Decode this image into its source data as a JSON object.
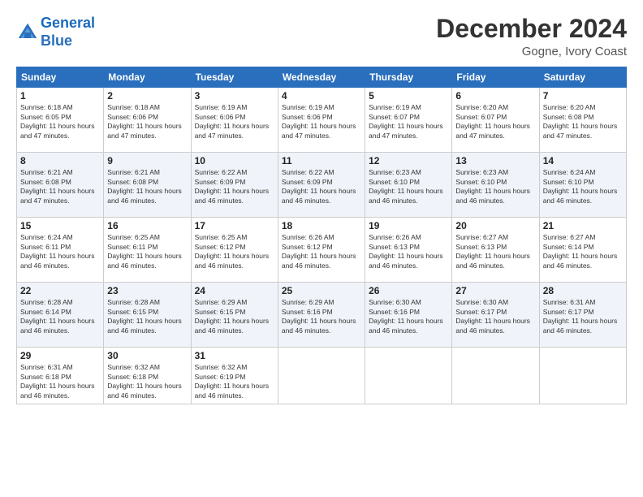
{
  "header": {
    "logo_line1": "General",
    "logo_line2": "Blue",
    "month": "December 2024",
    "location": "Gogne, Ivory Coast"
  },
  "weekdays": [
    "Sunday",
    "Monday",
    "Tuesday",
    "Wednesday",
    "Thursday",
    "Friday",
    "Saturday"
  ],
  "weeks": [
    [
      {
        "day": "1",
        "sunrise": "6:18 AM",
        "sunset": "6:05 PM",
        "daylight": "11 hours and 47 minutes."
      },
      {
        "day": "2",
        "sunrise": "6:18 AM",
        "sunset": "6:06 PM",
        "daylight": "11 hours and 47 minutes."
      },
      {
        "day": "3",
        "sunrise": "6:19 AM",
        "sunset": "6:06 PM",
        "daylight": "11 hours and 47 minutes."
      },
      {
        "day": "4",
        "sunrise": "6:19 AM",
        "sunset": "6:06 PM",
        "daylight": "11 hours and 47 minutes."
      },
      {
        "day": "5",
        "sunrise": "6:19 AM",
        "sunset": "6:07 PM",
        "daylight": "11 hours and 47 minutes."
      },
      {
        "day": "6",
        "sunrise": "6:20 AM",
        "sunset": "6:07 PM",
        "daylight": "11 hours and 47 minutes."
      },
      {
        "day": "7",
        "sunrise": "6:20 AM",
        "sunset": "6:08 PM",
        "daylight": "11 hours and 47 minutes."
      }
    ],
    [
      {
        "day": "8",
        "sunrise": "6:21 AM",
        "sunset": "6:08 PM",
        "daylight": "11 hours and 47 minutes."
      },
      {
        "day": "9",
        "sunrise": "6:21 AM",
        "sunset": "6:08 PM",
        "daylight": "11 hours and 46 minutes."
      },
      {
        "day": "10",
        "sunrise": "6:22 AM",
        "sunset": "6:09 PM",
        "daylight": "11 hours and 46 minutes."
      },
      {
        "day": "11",
        "sunrise": "6:22 AM",
        "sunset": "6:09 PM",
        "daylight": "11 hours and 46 minutes."
      },
      {
        "day": "12",
        "sunrise": "6:23 AM",
        "sunset": "6:10 PM",
        "daylight": "11 hours and 46 minutes."
      },
      {
        "day": "13",
        "sunrise": "6:23 AM",
        "sunset": "6:10 PM",
        "daylight": "11 hours and 46 minutes."
      },
      {
        "day": "14",
        "sunrise": "6:24 AM",
        "sunset": "6:10 PM",
        "daylight": "11 hours and 46 minutes."
      }
    ],
    [
      {
        "day": "15",
        "sunrise": "6:24 AM",
        "sunset": "6:11 PM",
        "daylight": "11 hours and 46 minutes."
      },
      {
        "day": "16",
        "sunrise": "6:25 AM",
        "sunset": "6:11 PM",
        "daylight": "11 hours and 46 minutes."
      },
      {
        "day": "17",
        "sunrise": "6:25 AM",
        "sunset": "6:12 PM",
        "daylight": "11 hours and 46 minutes."
      },
      {
        "day": "18",
        "sunrise": "6:26 AM",
        "sunset": "6:12 PM",
        "daylight": "11 hours and 46 minutes."
      },
      {
        "day": "19",
        "sunrise": "6:26 AM",
        "sunset": "6:13 PM",
        "daylight": "11 hours and 46 minutes."
      },
      {
        "day": "20",
        "sunrise": "6:27 AM",
        "sunset": "6:13 PM",
        "daylight": "11 hours and 46 minutes."
      },
      {
        "day": "21",
        "sunrise": "6:27 AM",
        "sunset": "6:14 PM",
        "daylight": "11 hours and 46 minutes."
      }
    ],
    [
      {
        "day": "22",
        "sunrise": "6:28 AM",
        "sunset": "6:14 PM",
        "daylight": "11 hours and 46 minutes."
      },
      {
        "day": "23",
        "sunrise": "6:28 AM",
        "sunset": "6:15 PM",
        "daylight": "11 hours and 46 minutes."
      },
      {
        "day": "24",
        "sunrise": "6:29 AM",
        "sunset": "6:15 PM",
        "daylight": "11 hours and 46 minutes."
      },
      {
        "day": "25",
        "sunrise": "6:29 AM",
        "sunset": "6:16 PM",
        "daylight": "11 hours and 46 minutes."
      },
      {
        "day": "26",
        "sunrise": "6:30 AM",
        "sunset": "6:16 PM",
        "daylight": "11 hours and 46 minutes."
      },
      {
        "day": "27",
        "sunrise": "6:30 AM",
        "sunset": "6:17 PM",
        "daylight": "11 hours and 46 minutes."
      },
      {
        "day": "28",
        "sunrise": "6:31 AM",
        "sunset": "6:17 PM",
        "daylight": "11 hours and 46 minutes."
      }
    ],
    [
      {
        "day": "29",
        "sunrise": "6:31 AM",
        "sunset": "6:18 PM",
        "daylight": "11 hours and 46 minutes."
      },
      {
        "day": "30",
        "sunrise": "6:32 AM",
        "sunset": "6:18 PM",
        "daylight": "11 hours and 46 minutes."
      },
      {
        "day": "31",
        "sunrise": "6:32 AM",
        "sunset": "6:19 PM",
        "daylight": "11 hours and 46 minutes."
      },
      null,
      null,
      null,
      null
    ]
  ]
}
